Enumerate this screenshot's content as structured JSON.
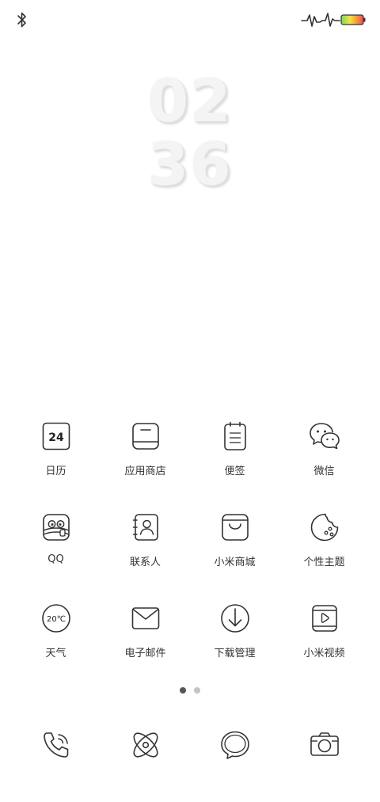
{
  "status_bar": {
    "icons": [
      "bluetooth-icon",
      "pulse-icon",
      "battery-icon"
    ],
    "battery_gradient": [
      "#7ed957",
      "#f7e04a",
      "#f59b3a",
      "#e84a6f"
    ]
  },
  "clock": {
    "hours": "02",
    "minutes": "36"
  },
  "apps": [
    [
      {
        "label": "日历",
        "icon": "calendar-icon",
        "badge": "24"
      },
      {
        "label": "应用商店",
        "icon": "app-store-icon"
      },
      {
        "label": "便签",
        "icon": "notes-icon"
      },
      {
        "label": "微信",
        "icon": "wechat-icon"
      }
    ],
    [
      {
        "label": "QQ",
        "icon": "qq-icon"
      },
      {
        "label": "联系人",
        "icon": "contacts-icon"
      },
      {
        "label": "小米商城",
        "icon": "mi-store-icon"
      },
      {
        "label": "个性主题",
        "icon": "themes-icon"
      }
    ],
    [
      {
        "label": "天气",
        "icon": "weather-icon",
        "badge": "20℃"
      },
      {
        "label": "电子邮件",
        "icon": "email-icon"
      },
      {
        "label": "下载管理",
        "icon": "download-icon"
      },
      {
        "label": "小米视频",
        "icon": "mi-video-icon"
      }
    ]
  ],
  "page_indicator": {
    "count": 2,
    "active": 1
  },
  "dock": [
    "phone-icon",
    "browser-icon",
    "messages-icon",
    "camera-icon"
  ]
}
